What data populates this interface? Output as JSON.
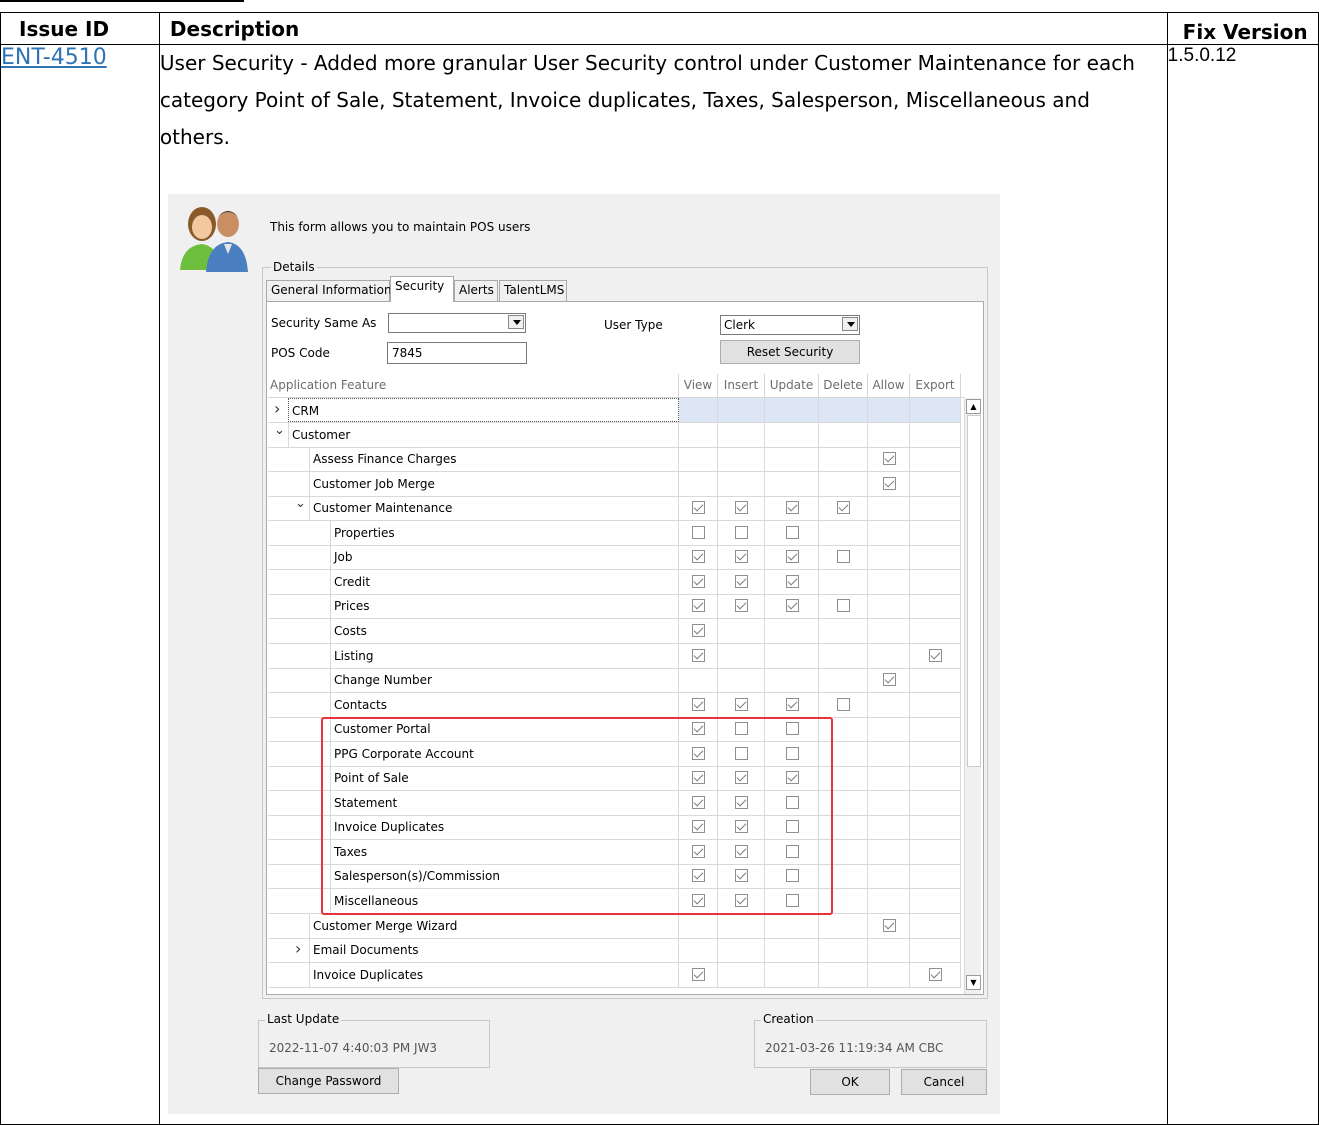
{
  "table": {
    "headers": [
      "Issue ID",
      "Description",
      "Fix Version"
    ],
    "row": {
      "issue_id": "ENT-4510",
      "description": "User Security - Added more granular User Security control under Customer Maintenance for each category Point of Sale, Statement, Invoice duplicates, Taxes, Salesperson, Miscellaneous and others.",
      "fix_version": "1.5.0.12"
    }
  },
  "dialog": {
    "intro": "This form allows you to maintain POS users",
    "details_label": "Details",
    "tabs": [
      "General Information",
      "Security",
      "Alerts",
      "TalentLMS"
    ],
    "security_same_as_label": "Security Same As",
    "security_same_as_value": "",
    "user_type_label": "User Type",
    "user_type_value": "Clerk",
    "pos_code_label": "POS Code",
    "pos_code_value": "7845",
    "reset_security": "Reset Security",
    "columns": [
      "Application Feature",
      "View",
      "Insert",
      "Update",
      "Delete",
      "Allow",
      "Export"
    ],
    "rows": [
      {
        "label": "CRM",
        "level": 0,
        "expander": "collapsed",
        "checks": [
          null,
          null,
          null,
          null,
          null,
          null
        ]
      },
      {
        "label": "Customer",
        "level": 0,
        "expander": "expanded",
        "checks": [
          null,
          null,
          null,
          null,
          null,
          null
        ]
      },
      {
        "label": "Assess Finance Charges",
        "level": 1,
        "expander": "none",
        "checks": [
          null,
          null,
          null,
          null,
          true,
          null
        ]
      },
      {
        "label": "Customer Job Merge",
        "level": 1,
        "expander": "none",
        "checks": [
          null,
          null,
          null,
          null,
          true,
          null
        ]
      },
      {
        "label": "Customer Maintenance",
        "level": 1,
        "expander": "expanded",
        "checks": [
          true,
          true,
          true,
          true,
          null,
          null
        ]
      },
      {
        "label": "Properties",
        "level": 2,
        "expander": "none",
        "checks": [
          false,
          false,
          false,
          null,
          null,
          null
        ]
      },
      {
        "label": "Job",
        "level": 2,
        "expander": "none",
        "checks": [
          true,
          true,
          true,
          false,
          null,
          null
        ]
      },
      {
        "label": "Credit",
        "level": 2,
        "expander": "none",
        "checks": [
          true,
          true,
          true,
          null,
          null,
          null
        ]
      },
      {
        "label": "Prices",
        "level": 2,
        "expander": "none",
        "checks": [
          true,
          true,
          true,
          false,
          null,
          null
        ]
      },
      {
        "label": "Costs",
        "level": 2,
        "expander": "none",
        "checks": [
          true,
          null,
          null,
          null,
          null,
          null
        ]
      },
      {
        "label": "Listing",
        "level": 2,
        "expander": "none",
        "checks": [
          true,
          null,
          null,
          null,
          null,
          true
        ]
      },
      {
        "label": "Change Number",
        "level": 2,
        "expander": "none",
        "checks": [
          null,
          null,
          null,
          null,
          true,
          null
        ]
      },
      {
        "label": "Contacts",
        "level": 2,
        "expander": "none",
        "checks": [
          true,
          true,
          true,
          false,
          null,
          null
        ]
      },
      {
        "label": "Customer Portal",
        "level": 2,
        "expander": "none",
        "checks": [
          true,
          false,
          false,
          null,
          null,
          null
        ]
      },
      {
        "label": "PPG Corporate Account",
        "level": 2,
        "expander": "none",
        "checks": [
          true,
          false,
          false,
          null,
          null,
          null
        ]
      },
      {
        "label": "Point of Sale",
        "level": 2,
        "expander": "none",
        "checks": [
          true,
          true,
          true,
          null,
          null,
          null
        ]
      },
      {
        "label": "Statement",
        "level": 2,
        "expander": "none",
        "checks": [
          true,
          true,
          false,
          null,
          null,
          null
        ]
      },
      {
        "label": "Invoice Duplicates",
        "level": 2,
        "expander": "none",
        "checks": [
          true,
          true,
          false,
          null,
          null,
          null
        ]
      },
      {
        "label": "Taxes",
        "level": 2,
        "expander": "none",
        "checks": [
          true,
          true,
          false,
          null,
          null,
          null
        ]
      },
      {
        "label": "Salesperson(s)/Commission",
        "level": 2,
        "expander": "none",
        "checks": [
          true,
          true,
          false,
          null,
          null,
          null
        ]
      },
      {
        "label": "Miscellaneous",
        "level": 2,
        "expander": "none",
        "checks": [
          true,
          true,
          false,
          null,
          null,
          null
        ]
      },
      {
        "label": "Customer Merge Wizard",
        "level": 1,
        "expander": "none",
        "checks": [
          null,
          null,
          null,
          null,
          true,
          null
        ]
      },
      {
        "label": "Email Documents",
        "level": 1,
        "expander": "collapsed",
        "checks": [
          null,
          null,
          null,
          null,
          null,
          null
        ]
      },
      {
        "label": "Invoice Duplicates",
        "level": 1,
        "expander": "none",
        "checks": [
          true,
          null,
          null,
          null,
          null,
          true
        ]
      }
    ],
    "last_update_label": "Last Update",
    "last_update_value": "2022-11-07 4:40:03 PM    JW3",
    "creation_label": "Creation",
    "creation_value": "2021-03-26 11:19:34 AM   CBC",
    "change_password": "Change Password",
    "ok": "OK",
    "cancel": "Cancel"
  },
  "colors": {
    "link": "#2e74b5",
    "highlight": "#e8323c",
    "selected_row": "#dce6f5"
  }
}
